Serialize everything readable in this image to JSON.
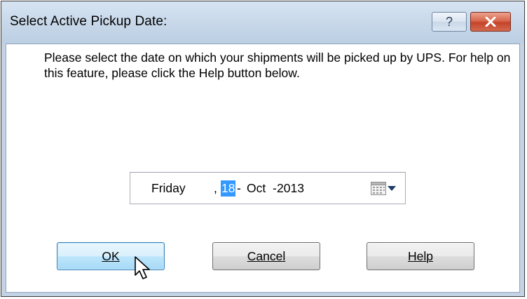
{
  "window": {
    "title": "Select Active Pickup Date:",
    "help_glyph": "?",
    "close_glyph": "x"
  },
  "message": "Please select the date on which your shipments will be picked up by UPS.  For help on this feature, please click the Help button below.",
  "date_picker": {
    "day_name": "Friday",
    "sep1": ",",
    "day": "18",
    "sep2": "-",
    "month": "Oct",
    "sep3": "-",
    "year": "2013",
    "icon": "calendar-icon"
  },
  "buttons": {
    "ok": "OK",
    "cancel": "Cancel",
    "help": "Help"
  },
  "colors": {
    "selection": "#3399ff",
    "close_button": "#c3442a",
    "title_bar": "#c5d6e8",
    "default_button": "#bee6fd"
  }
}
